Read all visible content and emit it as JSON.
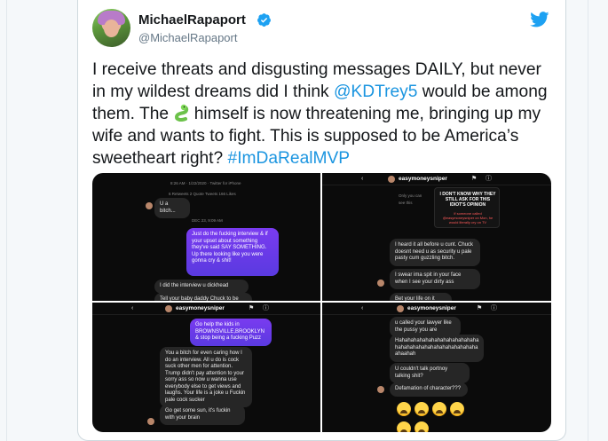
{
  "tweet": {
    "name": "MichaelRapaport",
    "handle": "@MichaelRapaport",
    "text_before_mention": "I receive threats and disgusting messages DAILY, but never in my wildest dreams did I think ",
    "mention": "@KDTrey5",
    "text_after_mention": " would be among them. The ",
    "emoji_icon": "snake-emoji",
    "text_after_emoji": " himself is now threatening me, bringing up my wife and wants to fight. This is supposed to be America’s sweetheart right? ",
    "hashtag": "#ImDaRealMVP",
    "brand_color": "#1da1f2",
    "link_color": "#1b95e0"
  },
  "screenshots": {
    "top_left": {
      "meta_line": "8:26 AM · 1/22/2020 · Twitter for iPhone",
      "stats": "6 Retweets  2 Quote Tweets  166 Likes",
      "msg1": "U a bitch...",
      "date": "DEC 23, 9:09 AM",
      "out_msg": "Just do the fucking interview & if your upset about something they've said SAY SOMETHING. Up there looking like you were gonna cry & shit!",
      "in_msg2": "I did the interview u dickhead",
      "in_msg3": "Tell your baby daddy Chuck to be"
    },
    "top_right": {
      "username": "easymoneysniper",
      "story_text": "Only you can see this",
      "caption1": "I DON'T KNOW WHY THEY STILL ASK FOR THIS IDIOT'S OPINION",
      "caption2": "If someone called @easymoneysniper on Mon, he would literally cry on TV",
      "msg1": "I heard it all before u cunt. Chuck doesnt need u as security u pale pasty cum guzzling bitch.",
      "msg2": "I swear ima spit in your face when I see your dirty ass",
      "msg3": "Bet your life on it"
    },
    "bottom_left": {
      "username": "easymoneysniper",
      "out_msg": "Go help the kids in BROWNSVILLE,BROOKLYN & stop being a fucking Puzz",
      "msg1": "You a bitch for even caring how I do an interview. All u do is cock suck other men for attention. Trump didn't pay attention to your sorry ass so now u wanna use everybody else to get views and laughs. Your life is a joke u Fuckin pale cock sucker",
      "msg2": "Go get some sun, it's fuckin with your brain"
    },
    "bottom_right": {
      "username": "easymoneysniper",
      "msg1": "u called your lawyer like the pussy you are",
      "msg2": "Hahahahahahahahahahahahahaha hahahahahahahahahahahahahaha ahaahah",
      "msg3": "U couldn't talk portnoy talking shit?",
      "msg4": "Defamation of character???",
      "emoji_icon": "crying-laughing-emoji"
    }
  }
}
